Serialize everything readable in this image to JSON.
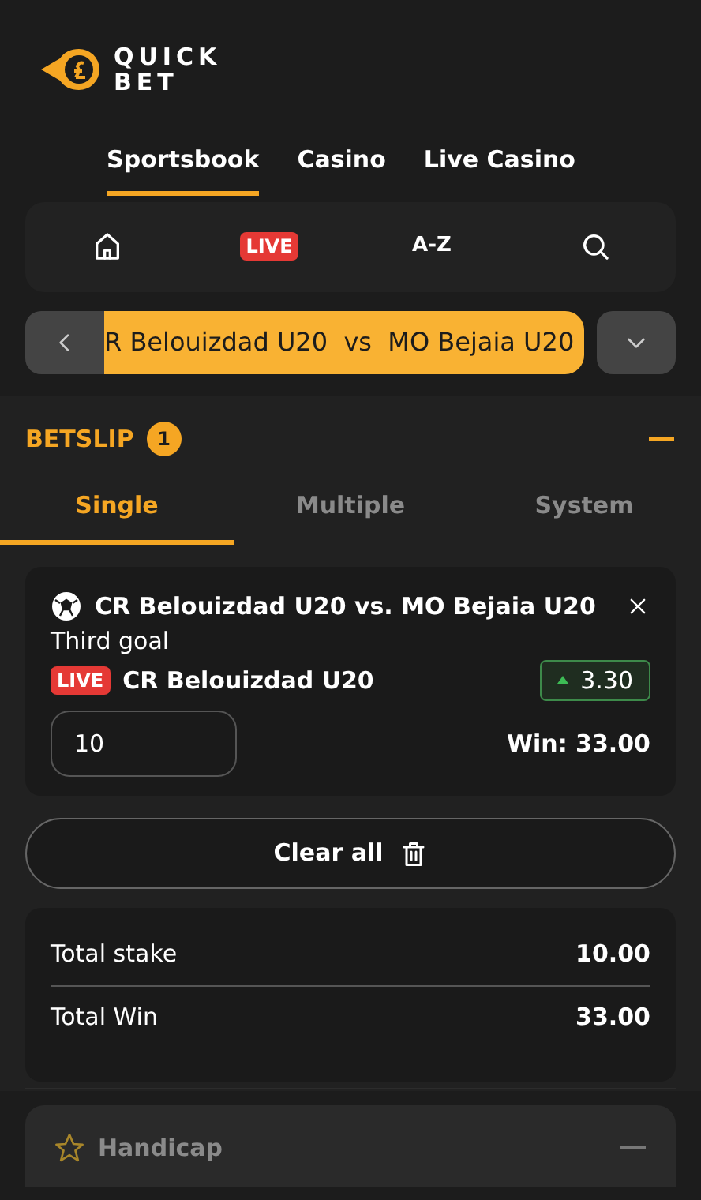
{
  "logo": {
    "line1": "QUICK",
    "line2": "BET"
  },
  "main_tabs": [
    {
      "label": "Sportsbook",
      "selected": true
    },
    {
      "label": "Casino",
      "selected": false
    },
    {
      "label": "Live Casino",
      "selected": false
    }
  ],
  "quick_nav": [
    {
      "kind": "home"
    },
    {
      "kind": "live",
      "label": "LIVE"
    },
    {
      "kind": "az",
      "label": "A-Z"
    },
    {
      "kind": "search"
    }
  ],
  "match_bar": {
    "title": "R Belouizdad U20  vs  MO Bejaia U20"
  },
  "betslip": {
    "title": "BETSLIP",
    "count": "1",
    "expanded": true,
    "tabs": [
      {
        "label": "Single",
        "selected": true
      },
      {
        "label": "Multiple",
        "selected": false
      },
      {
        "label": "System",
        "selected": false
      }
    ],
    "selections": [
      {
        "event": "CR Belouizdad U20 vs. MO Bejaia U20",
        "market": "Third goal",
        "live_badge": "LIVE",
        "pick": "CR Belouizdad U20",
        "odds": "3.30",
        "odds_rising": true,
        "stake": "10",
        "win": "Win: 33.00"
      }
    ],
    "clear_button": "Clear all",
    "totals": [
      {
        "label": "Total stake",
        "value": "10.00"
      },
      {
        "label": "Total Win",
        "value": "33.00"
      }
    ]
  },
  "markets": [
    {
      "title": "Handicap",
      "favorite": false,
      "expanded": true
    }
  ]
}
